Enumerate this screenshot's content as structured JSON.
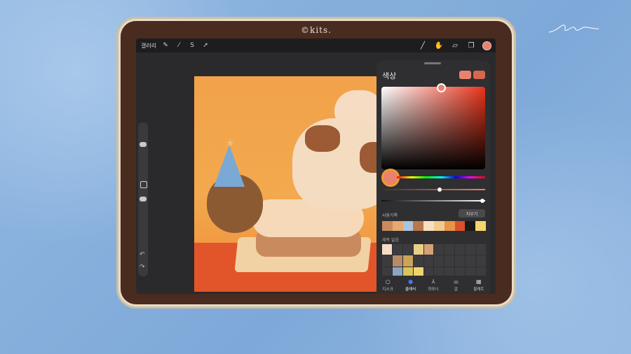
{
  "brand": "©kits.",
  "toolbar": {
    "gallery_label": "갤러리",
    "left_icons": [
      "wrench-icon",
      "magic-wand-icon",
      "selection-icon",
      "transform-arrow-icon"
    ],
    "right_tools": [
      "brush-icon",
      "smudge-icon",
      "eraser-icon",
      "layers-icon"
    ],
    "current_color": "#e8826e"
  },
  "color_panel": {
    "title": "색상",
    "current_swatches": [
      "#e8826e",
      "#d8674f"
    ],
    "history_label": "사용기록",
    "clear_label": "지우기",
    "history_colors": [
      "#c98a5d",
      "#e8a871",
      "#a9c4de",
      "#b9774b",
      "#f7e0c2",
      "#f3c98d",
      "#e89447",
      "#d9502a",
      "#1a1a1a",
      "#f4d46b"
    ],
    "palette_label": "제목 없음",
    "palette_colors": [
      "#f6dcc6",
      "#d3a274",
      "#b58c67",
      "#c9a45a",
      "#8aa5c2",
      "#d9c45b",
      "#f0d36e",
      "#e8cf87"
    ],
    "tabs": [
      {
        "label": "디스크",
        "icon": "disc-icon",
        "active": false
      },
      {
        "label": "클래식",
        "icon": "classic-icon",
        "active": true
      },
      {
        "label": "하모니",
        "icon": "harmony-icon",
        "active": false
      },
      {
        "label": "값",
        "icon": "sliders-icon",
        "active": false
      },
      {
        "label": "팔레트",
        "icon": "palette-grid-icon",
        "active": false
      }
    ]
  },
  "canvas_swatches": [
    "#d9502a",
    "#9c5a35",
    "#b6b24a"
  ]
}
